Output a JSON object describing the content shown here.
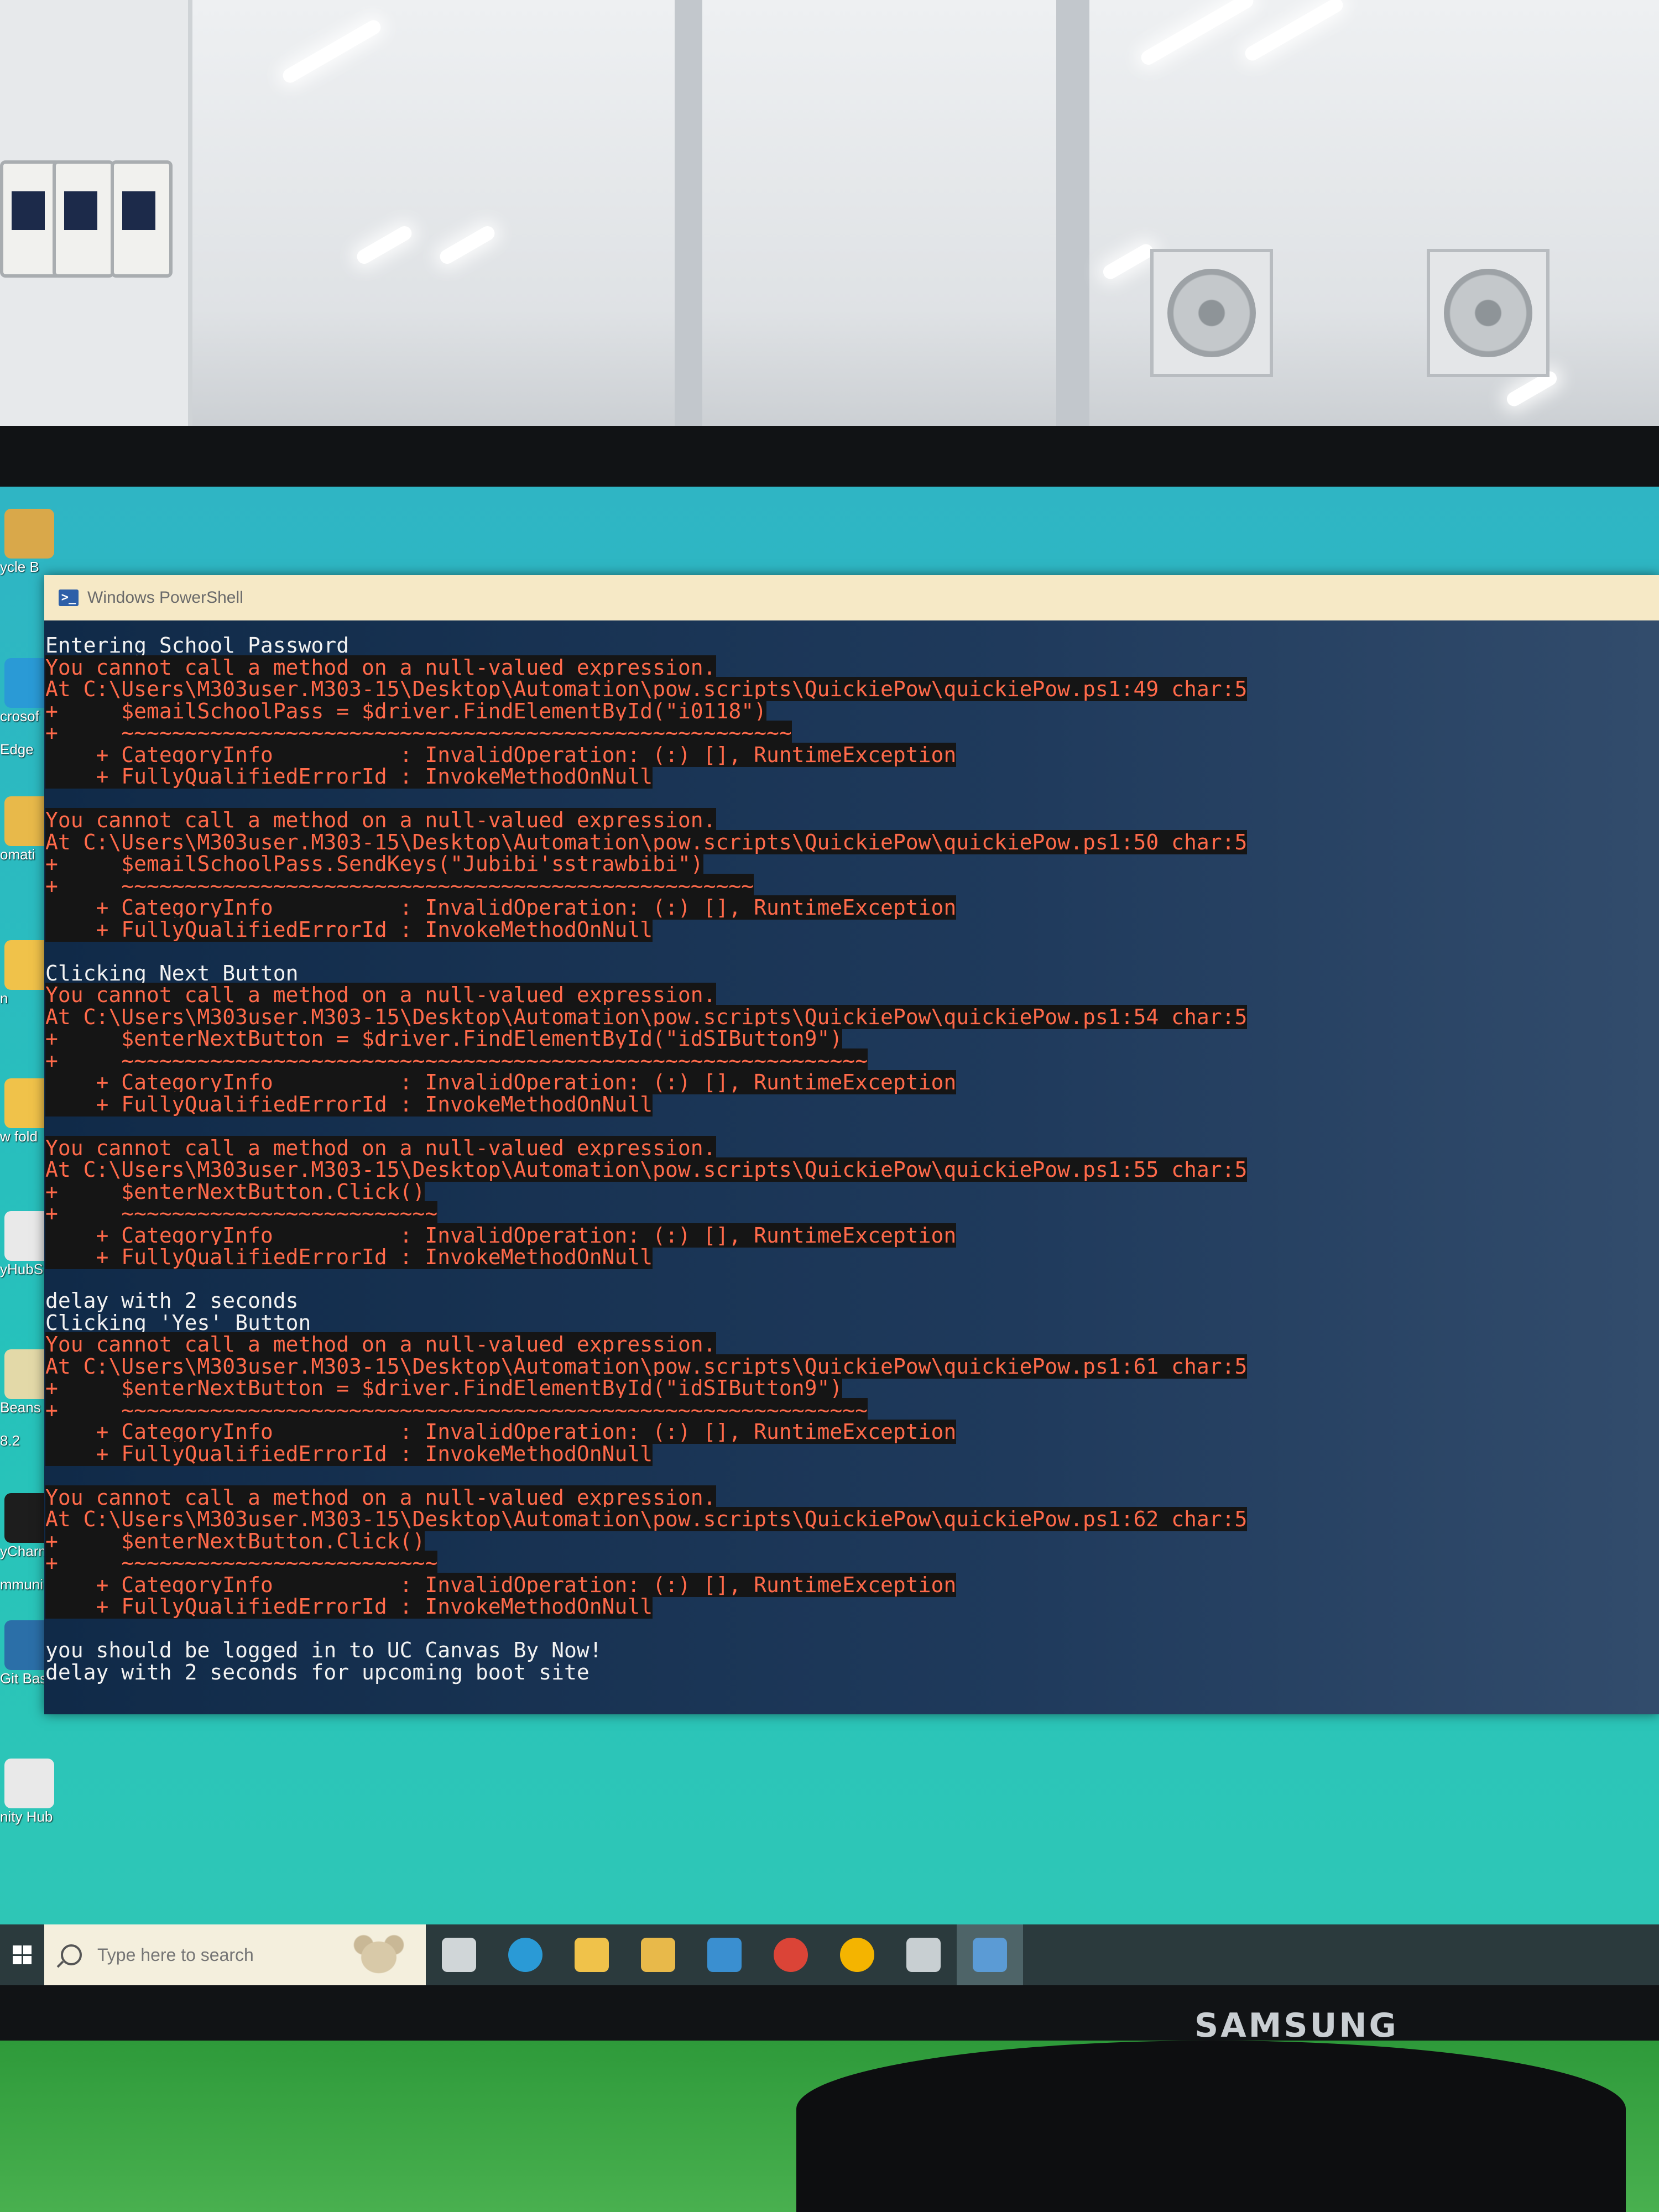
{
  "window": {
    "title": "Windows PowerShell"
  },
  "console_lines": [
    {
      "kind": "out",
      "text": "Entering School Password"
    },
    {
      "kind": "err",
      "text": "You cannot call a method on a null-valued expression."
    },
    {
      "kind": "err",
      "text": "At C:\\Users\\M303user.M303-15\\Desktop\\Automation\\pow.scripts\\QuickiePow\\quickiePow.ps1:49 char:5"
    },
    {
      "kind": "err",
      "text": "+     $emailSchoolPass = $driver.FindElementById(\"i0118\")"
    },
    {
      "kind": "err",
      "text": "+     ~~~~~~~~~~~~~~~~~~~~~~~~~~~~~~~~~~~~~~~~~~~~~~~~~~~~~"
    },
    {
      "kind": "err",
      "text": "    + CategoryInfo          : InvalidOperation: (:) [], RuntimeException"
    },
    {
      "kind": "err",
      "text": "    + FullyQualifiedErrorId : InvokeMethodOnNull"
    },
    {
      "kind": "blank",
      "text": ""
    },
    {
      "kind": "err",
      "text": "You cannot call a method on a null-valued expression."
    },
    {
      "kind": "err",
      "text": "At C:\\Users\\M303user.M303-15\\Desktop\\Automation\\pow.scripts\\QuickiePow\\quickiePow.ps1:50 char:5"
    },
    {
      "kind": "err",
      "text": "+     $emailSchoolPass.SendKeys(\"Jubibi'sstrawbibi\")"
    },
    {
      "kind": "err",
      "text": "+     ~~~~~~~~~~~~~~~~~~~~~~~~~~~~~~~~~~~~~~~~~~~~~~~~~~"
    },
    {
      "kind": "err",
      "text": "    + CategoryInfo          : InvalidOperation: (:) [], RuntimeException"
    },
    {
      "kind": "err",
      "text": "    + FullyQualifiedErrorId : InvokeMethodOnNull"
    },
    {
      "kind": "blank",
      "text": ""
    },
    {
      "kind": "out",
      "text": "Clicking Next Button"
    },
    {
      "kind": "err",
      "text": "You cannot call a method on a null-valued expression."
    },
    {
      "kind": "err",
      "text": "At C:\\Users\\M303user.M303-15\\Desktop\\Automation\\pow.scripts\\QuickiePow\\quickiePow.ps1:54 char:5"
    },
    {
      "kind": "err",
      "text": "+     $enterNextButton = $driver.FindElementById(\"idSIButton9\")"
    },
    {
      "kind": "err",
      "text": "+     ~~~~~~~~~~~~~~~~~~~~~~~~~~~~~~~~~~~~~~~~~~~~~~~~~~~~~~~~~~~"
    },
    {
      "kind": "err",
      "text": "    + CategoryInfo          : InvalidOperation: (:) [], RuntimeException"
    },
    {
      "kind": "err",
      "text": "    + FullyQualifiedErrorId : InvokeMethodOnNull"
    },
    {
      "kind": "blank",
      "text": ""
    },
    {
      "kind": "err",
      "text": "You cannot call a method on a null-valued expression."
    },
    {
      "kind": "err",
      "text": "At C:\\Users\\M303user.M303-15\\Desktop\\Automation\\pow.scripts\\QuickiePow\\quickiePow.ps1:55 char:5"
    },
    {
      "kind": "err",
      "text": "+     $enterNextButton.Click()"
    },
    {
      "kind": "err",
      "text": "+     ~~~~~~~~~~~~~~~~~~~~~~~~~"
    },
    {
      "kind": "err",
      "text": "    + CategoryInfo          : InvalidOperation: (:) [], RuntimeException"
    },
    {
      "kind": "err",
      "text": "    + FullyQualifiedErrorId : InvokeMethodOnNull"
    },
    {
      "kind": "blank",
      "text": ""
    },
    {
      "kind": "out",
      "text": "delay with 2 seconds"
    },
    {
      "kind": "out",
      "text": "Clicking 'Yes' Button"
    },
    {
      "kind": "err",
      "text": "You cannot call a method on a null-valued expression."
    },
    {
      "kind": "err",
      "text": "At C:\\Users\\M303user.M303-15\\Desktop\\Automation\\pow.scripts\\QuickiePow\\quickiePow.ps1:61 char:5"
    },
    {
      "kind": "err",
      "text": "+     $enterNextButton = $driver.FindElementById(\"idSIButton9\")"
    },
    {
      "kind": "err",
      "text": "+     ~~~~~~~~~~~~~~~~~~~~~~~~~~~~~~~~~~~~~~~~~~~~~~~~~~~~~~~~~~~"
    },
    {
      "kind": "err",
      "text": "    + CategoryInfo          : InvalidOperation: (:) [], RuntimeException"
    },
    {
      "kind": "err",
      "text": "    + FullyQualifiedErrorId : InvokeMethodOnNull"
    },
    {
      "kind": "blank",
      "text": ""
    },
    {
      "kind": "err",
      "text": "You cannot call a method on a null-valued expression."
    },
    {
      "kind": "err",
      "text": "At C:\\Users\\M303user.M303-15\\Desktop\\Automation\\pow.scripts\\QuickiePow\\quickiePow.ps1:62 char:5"
    },
    {
      "kind": "err",
      "text": "+     $enterNextButton.Click()"
    },
    {
      "kind": "err",
      "text": "+     ~~~~~~~~~~~~~~~~~~~~~~~~~"
    },
    {
      "kind": "err",
      "text": "    + CategoryInfo          : InvalidOperation: (:) [], RuntimeException"
    },
    {
      "kind": "err",
      "text": "    + FullyQualifiedErrorId : InvokeMethodOnNull"
    },
    {
      "kind": "blank",
      "text": ""
    },
    {
      "kind": "out",
      "text": "you should be logged in to UC Canvas By Now!"
    },
    {
      "kind": "out",
      "text": "delay with 2 seconds for upcoming boot site"
    }
  ],
  "desktop_icons": [
    {
      "label": "ycle B",
      "icon": "recycle-bin-icon",
      "color": "#d9a84a"
    },
    {
      "label": "crosof",
      "icon": "edge-icon",
      "color": "#2a9ad6"
    },
    {
      "label": "Edge",
      "icon": "",
      "color": ""
    },
    {
      "label": "omati",
      "icon": "folder-icon",
      "color": "#e8b94a"
    },
    {
      "label": "n",
      "icon": "folder-icon",
      "color": "#f0c24a"
    },
    {
      "label": "w fold",
      "icon": "folder-icon",
      "color": "#f0c24a"
    },
    {
      "label": "yHubS",
      "icon": "unity-hub-icon",
      "color": "#e9e9e9"
    },
    {
      "label": "Beans I",
      "icon": "netbeans-icon",
      "color": "#e3d9a8"
    },
    {
      "label": "8.2",
      "icon": "",
      "color": ""
    },
    {
      "label": "yCharm",
      "icon": "pycharm-icon",
      "color": "#1d1d1d"
    },
    {
      "label": "mmuni",
      "icon": "",
      "color": ""
    },
    {
      "label": "Git Bash",
      "icon": "git-bash-icon",
      "color": "#2b6fa8"
    },
    {
      "label": "nity Hub",
      "icon": "unity-hub-icon",
      "color": "#e9e9e9"
    }
  ],
  "taskbar": {
    "search_placeholder": "Type here to search",
    "apps": [
      {
        "icon": "task-view-icon",
        "color": "#d0d6d8"
      },
      {
        "icon": "edge-icon",
        "color": "#2a9ad6"
      },
      {
        "icon": "file-explorer-icon",
        "color": "#f0c24a"
      },
      {
        "icon": "store-icon",
        "color": "#e8b94a"
      },
      {
        "icon": "mail-icon",
        "color": "#3a8fd0"
      },
      {
        "icon": "chrome-icon",
        "color": "#db4437"
      },
      {
        "icon": "chrome-icon",
        "color": "#f4b400"
      },
      {
        "icon": "settings-icon",
        "color": "#c8cfd2"
      },
      {
        "icon": "powershell-icon",
        "color": "#5b9bd5"
      }
    ]
  },
  "monitor": {
    "brand": "SAMSUNG"
  }
}
